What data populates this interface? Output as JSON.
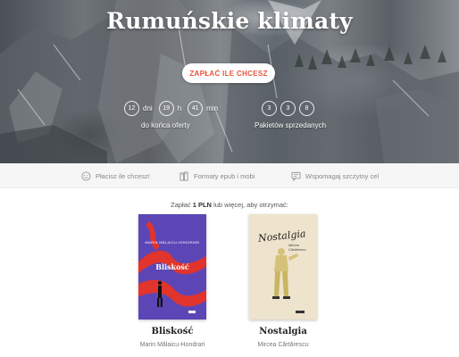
{
  "hero": {
    "title": "Rumuńskie klimaty",
    "pay_button": "ZAPŁAĆ ILE CHCESZ",
    "countdown": {
      "days_value": "12",
      "days_unit": "dni",
      "hours_value": "19",
      "hours_unit": "h",
      "minutes_value": "41",
      "minutes_unit": "min",
      "label": "do końca oferty"
    },
    "sold": {
      "digits": [
        "3",
        "3",
        "8"
      ],
      "label": "Pakietów sprzedanych"
    }
  },
  "features": [
    {
      "icon": "smiley-icon",
      "label": "Płacisz ile chcesz!"
    },
    {
      "icon": "books-icon",
      "label": "Formaty epub i mobi"
    },
    {
      "icon": "chat-icon",
      "label": "Wspomagaj szczytny cel"
    }
  ],
  "offer": {
    "prefix": "Zapłać",
    "amount": "1 PLN",
    "suffix": "lub więcej, aby otrzymać:"
  },
  "books": [
    {
      "title": "Bliskość",
      "author": "Marin Mălaicu-Hondrari",
      "cover_title": "Bliskość",
      "cover_author": "MARIN MĂLAICU-HONDRARI",
      "colors": {
        "bg": "#5c46b6",
        "accent": "#e0342c"
      }
    },
    {
      "title": "Nostalgia",
      "author": "Mircea Cărtărescu",
      "cover_title": "Nostalgia",
      "cover_author": "Mircea Cărtărescu",
      "colors": {
        "bg": "#eee3cc",
        "accent": "#d4c27a"
      }
    }
  ],
  "colors": {
    "accent": "#e8553e",
    "feature_bar": "#f6f6f6"
  }
}
